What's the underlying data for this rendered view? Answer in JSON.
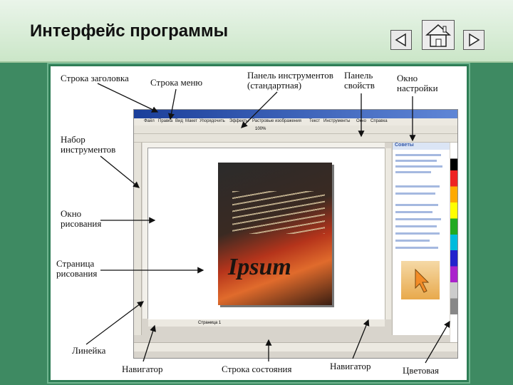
{
  "slide": {
    "title": "Интерфейс программы"
  },
  "labels": {
    "title_bar": "Строка заголовка",
    "menu_bar": "Строка меню",
    "standard_toolbar": "Панель инструментов\n(стандартная)",
    "property_bar": "Панель\nсвойств",
    "docker": "Окно\nнастройки",
    "toolbox": "Набор\nинструментов",
    "drawing_window": "Окно\nрисования",
    "drawing_page": "Страница\nрисования",
    "ruler": "Линейка",
    "navigator_left": "Навигатор",
    "status_bar": "Строка состояния",
    "navigator_right": "Навигатор",
    "color_palette": "Цветовая"
  },
  "app": {
    "menu_items": [
      "Файл",
      "Правка",
      "Вид",
      "Макет",
      "Упорядочить",
      "Эффекты",
      "Растровые изображения",
      "Текст",
      "Инструменты",
      "Окно",
      "Справка"
    ],
    "zoom": "100%",
    "page_tab": "Страница 1",
    "docker_title": "Советы",
    "poster_word": "Ipsum"
  },
  "colors": {
    "frame_green": "#2e7d55",
    "background_green": "#3e8a62",
    "title_bar_blue": "#1b3f9a"
  }
}
